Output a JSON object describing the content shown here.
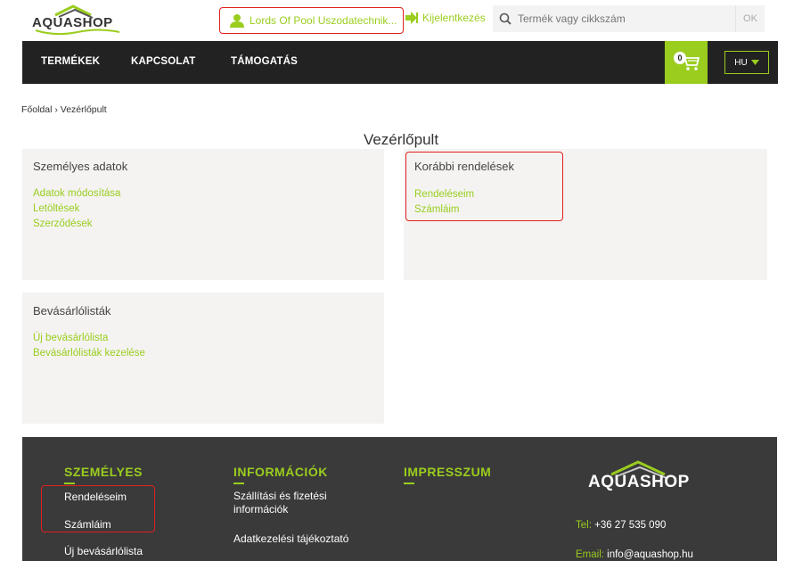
{
  "header": {
    "logo_text": "AQUASHOP",
    "user_name": "Lords Of Pool Uszodatechnik...",
    "logout_label": "Kijelentkezés",
    "search_placeholder": "Termék vagy cikkszám",
    "search_button": "OK"
  },
  "nav": {
    "items": [
      "TERMÉKEK",
      "KAPCSOLAT",
      "TÁMOGATÁS"
    ],
    "cart_count": "0",
    "language": "HU"
  },
  "breadcrumb": "Főoldal › Vezérlőpult",
  "page_title": "Vezérlőpult",
  "cards": {
    "personal": {
      "title": "Személyes adatok",
      "links": [
        "Adatok módosítása",
        "Letöltések",
        "Szerződések"
      ]
    },
    "orders": {
      "title": "Korábbi rendelések",
      "links": [
        "Rendeléseim",
        "Számláim"
      ]
    },
    "shopping_lists": {
      "title": "Bevásárlólisták",
      "links": [
        "Új bevásárlólista",
        "Bevásárlólisták kezelése"
      ]
    }
  },
  "footer": {
    "personal": {
      "heading": "SZEMÉLYES",
      "links": [
        "Rendeléseim",
        "Számláim",
        "Új bevásárlólista"
      ]
    },
    "info": {
      "heading": "INFORMÁCIÓK",
      "links": [
        "Szállítási és fizetési információk",
        "Adatkezelési tájékoztató"
      ]
    },
    "impressum": {
      "heading": "IMPRESSZUM"
    },
    "logo_text": "AQUASHOP",
    "phone_label": "Tel:",
    "phone": "+36 27 535 090",
    "email_label": "Email:",
    "email": "info@aquashop.hu"
  },
  "colors": {
    "accent": "#9acd1e",
    "nav_bg": "#222222",
    "footer_bg": "#3a3a3a",
    "card_bg": "#f4f3f2",
    "highlight": "#e02020"
  },
  "icons": [
    "user-icon",
    "logout-icon",
    "search-icon",
    "cart-icon",
    "caret-down-icon"
  ]
}
